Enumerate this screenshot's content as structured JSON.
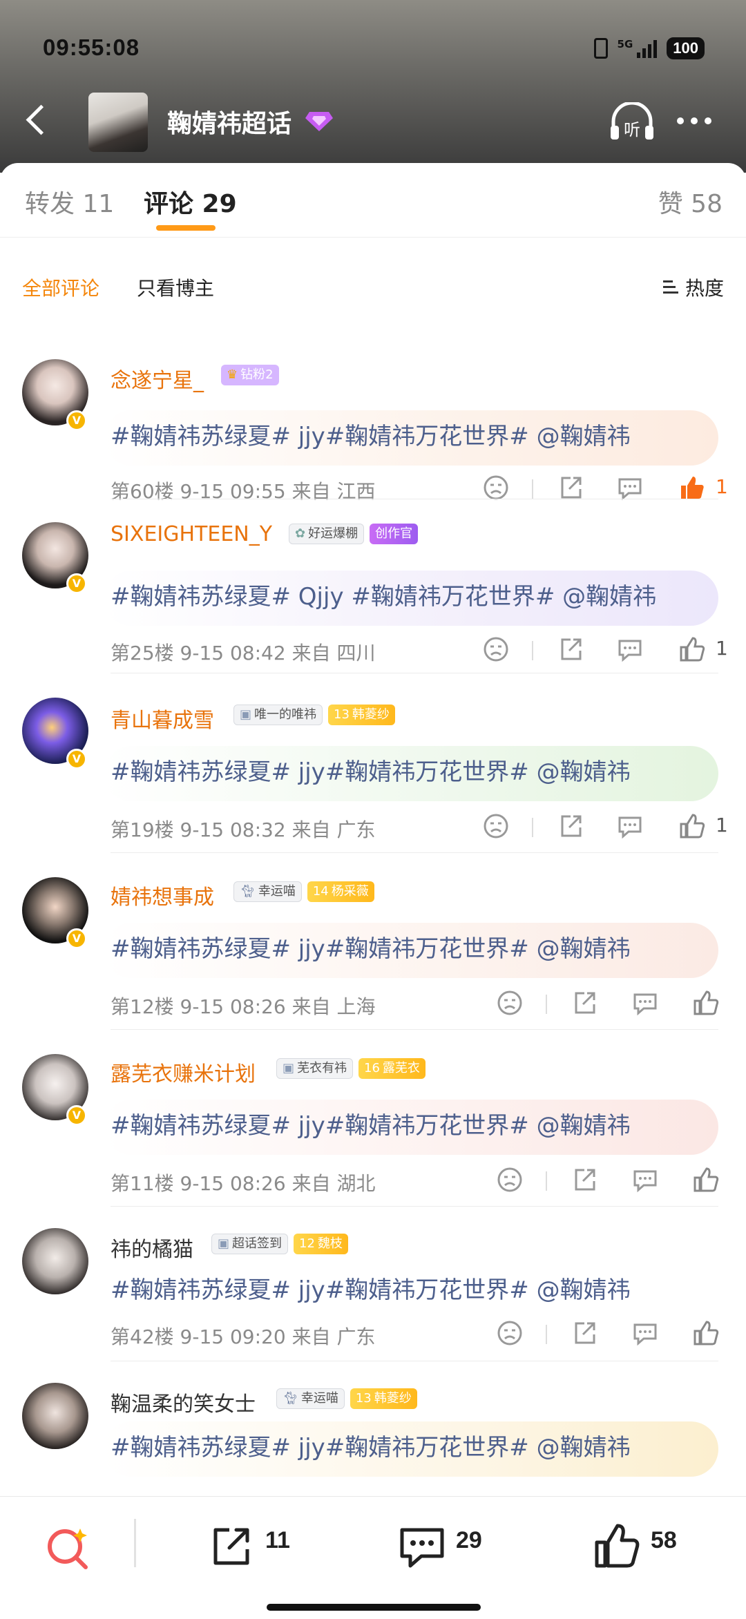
{
  "status_bar": {
    "time": "09:55:08",
    "network": "5G",
    "battery": "100"
  },
  "nav": {
    "title": "鞠婧祎超话",
    "listen_label": "听"
  },
  "tabs": [
    {
      "label": "转发 11"
    },
    {
      "label": "评论 29"
    },
    {
      "label": "赞 58"
    }
  ],
  "filters": {
    "all": "全部评论",
    "owner": "只看博主",
    "sort": "热度"
  },
  "comments": [
    {
      "username": "念遂宁星_",
      "badges": [
        "钻粉2"
      ],
      "text": "#鞠婧祎苏绿夏# jjy#鞠婧祎万花世界# @鞠婧祎",
      "meta": "第60楼  9-15 09:55  来自 江西",
      "likes": "1",
      "liked": true
    },
    {
      "username": "SIXEIGHTEEN_Y",
      "badges": [
        "好运爆棚",
        "创作官"
      ],
      "text": "#鞠婧祎苏绿夏# Qjjy #鞠婧祎万花世界# @鞠婧祎",
      "meta": "第25楼  9-15 08:42  来自 四川",
      "likes": "1",
      "liked": false
    },
    {
      "username": "青山暮成雪",
      "badges": [
        "唯一的唯祎",
        "13",
        "韩菱纱"
      ],
      "text": "#鞠婧祎苏绿夏# jjy#鞠婧祎万花世界# @鞠婧祎",
      "meta": "第19楼  9-15 08:32  来自 广东",
      "likes": "1",
      "liked": false
    },
    {
      "username": "婧祎想事成",
      "badges": [
        "幸运喵",
        "14",
        "杨采薇"
      ],
      "text": "#鞠婧祎苏绿夏# jjy#鞠婧祎万花世界# @鞠婧祎",
      "meta": "第12楼  9-15 08:26  来自 上海",
      "likes": "",
      "liked": false
    },
    {
      "username": "露芜衣赚米计划",
      "badges": [
        "芜衣有祎",
        "16",
        "露芜衣"
      ],
      "text": "#鞠婧祎苏绿夏# jjy#鞠婧祎万花世界# @鞠婧祎",
      "meta": "第11楼  9-15 08:26  来自 湖北",
      "likes": "",
      "liked": false
    },
    {
      "username": "祎的橘猫",
      "badges": [
        "超话签到",
        "12",
        "魏枝"
      ],
      "text": "#鞠婧祎苏绿夏# jjy#鞠婧祎万花世界# @鞠婧祎",
      "meta": "第42楼  9-15 09:20  来自 广东",
      "likes": "",
      "liked": false
    },
    {
      "username": "鞠温柔的笑女士",
      "badges": [
        "幸运喵",
        "13",
        "韩菱纱"
      ],
      "text": "#鞠婧祎苏绿夏# jjy#鞠婧祎万花世界# @鞠婧祎",
      "meta": "",
      "likes": "",
      "liked": false
    }
  ],
  "bottom_bar": {
    "repost_count": "11",
    "comment_count": "29",
    "like_count": "58"
  },
  "colors": {
    "accent": "#f4860b",
    "link": "#4d5f8c",
    "liked": "#f86c16"
  }
}
